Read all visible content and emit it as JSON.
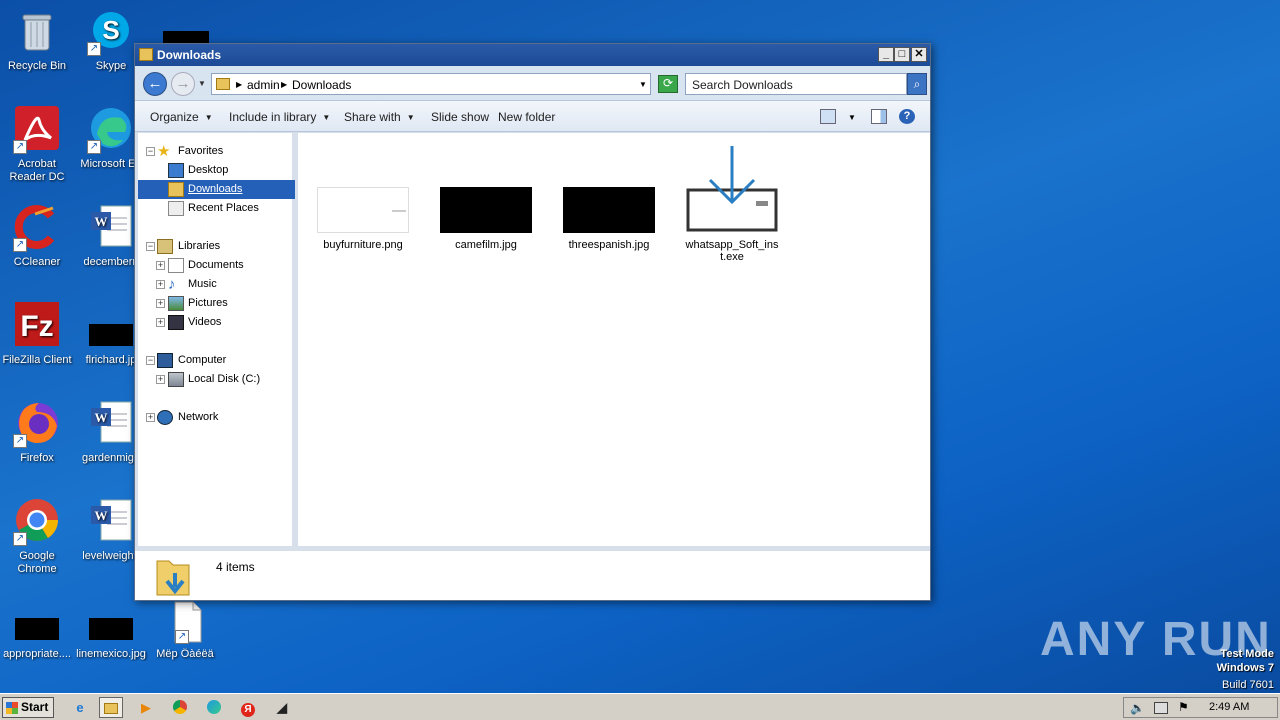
{
  "desktop": {
    "icons": [
      {
        "label": "Recycle Bin",
        "icon": "recycle-bin-icon"
      },
      {
        "label": "Skype",
        "icon": "skype-icon"
      },
      {
        "label": "Acrobat Reader DC",
        "icon": "acrobat-icon"
      },
      {
        "label": "Microsoft Ed",
        "icon": "edge-icon"
      },
      {
        "label": "CCleaner",
        "icon": "ccleaner-icon"
      },
      {
        "label": "decembern",
        "icon": "word-doc-icon"
      },
      {
        "label": "FileZilla Client",
        "icon": "filezilla-icon"
      },
      {
        "label": "flrichard.jp",
        "icon": "image-file-icon"
      },
      {
        "label": "Firefox",
        "icon": "firefox-icon"
      },
      {
        "label": "gardenmigh",
        "icon": "word-doc-icon"
      },
      {
        "label": "Google Chrome",
        "icon": "chrome-icon"
      },
      {
        "label": "levelweight.",
        "icon": "word-doc-icon"
      },
      {
        "label": "appropriate....",
        "icon": "image-file-icon"
      },
      {
        "label": "linemexico.jpg",
        "icon": "image-file-icon"
      },
      {
        "label": "Mëp Ôàéëä",
        "icon": "blank-file-icon"
      }
    ]
  },
  "window": {
    "title": "Downloads",
    "breadcrumb": [
      "admin",
      "Downloads"
    ],
    "search_placeholder": "Search Downloads",
    "toolbar": {
      "organize": "Organize",
      "include_in_library": "Include in library",
      "share_with": "Share with",
      "slide_show": "Slide show",
      "new_folder": "New folder"
    },
    "nav": {
      "favorites": "Favorites",
      "desktop": "Desktop",
      "downloads": "Downloads",
      "recent_places": "Recent Places",
      "libraries": "Libraries",
      "documents": "Documents",
      "music": "Music",
      "pictures": "Pictures",
      "videos": "Videos",
      "computer": "Computer",
      "local_disk": "Local Disk (C:)",
      "network": "Network"
    },
    "files": [
      {
        "name": "buyfurniture.png",
        "thumb": "white"
      },
      {
        "name": "camefilm.jpg",
        "thumb": "black"
      },
      {
        "name": "threespanish.jpg",
        "thumb": "black"
      },
      {
        "name": "whatsapp_Soft_inst.exe",
        "thumb": "installer"
      }
    ],
    "status": "4 items"
  },
  "taskbar": {
    "start": "Start",
    "clock": "2:49 AM"
  },
  "watermark": "ANY RUN",
  "test_mode": {
    "line1": "Test Mode",
    "line2": "Windows 7",
    "line3": "Build 7601"
  },
  "colors": {
    "desktop": "#1a73cc",
    "titlebar": "#2a5aa8",
    "selection": "#2460b8"
  }
}
